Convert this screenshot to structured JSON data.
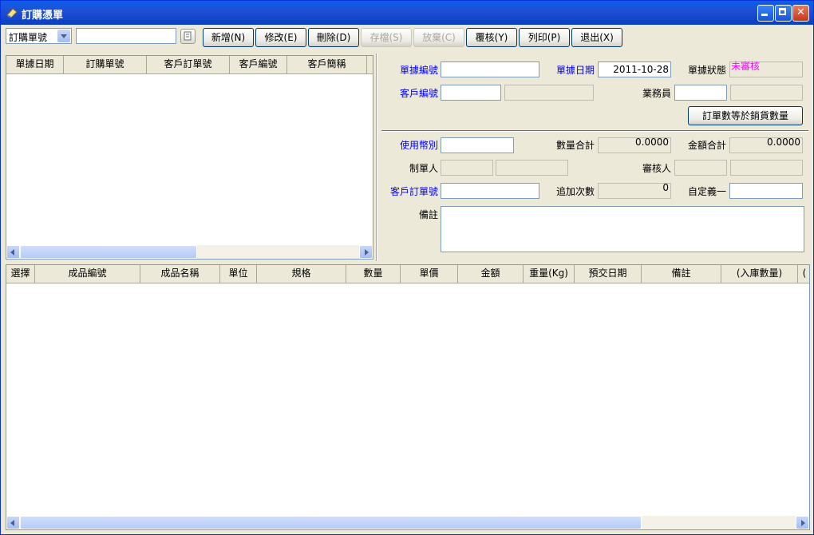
{
  "window": {
    "title": "訂購憑單"
  },
  "toolbar": {
    "search_field_selected": "訂購單號",
    "search_value": "",
    "buttons": {
      "add": "新增(N)",
      "edit": "修改(E)",
      "delete": "刪除(D)",
      "save": "存檔(S)",
      "cancel": "放棄(C)",
      "review": "覆核(Y)",
      "print": "列印(P)",
      "exit": "退出(X)"
    }
  },
  "order_list": {
    "columns": [
      "單據日期",
      "訂購單號",
      "客戶訂單號",
      "客戶編號",
      "客戶簡稱"
    ]
  },
  "form": {
    "doc_no_label": "單據編號",
    "doc_date_label": "單據日期",
    "doc_date_value": "2011-10-28",
    "doc_status_label": "單據狀態",
    "doc_status_value": "未審核",
    "customer_no_label": "客戶編號",
    "salesperson_label": "業務員",
    "match_button": "訂單數等於銷貨數量",
    "currency_label": "使用幣別",
    "qty_total_label": "數量合計",
    "qty_total_value": "0.0000",
    "amount_total_label": "金額合計",
    "amount_total_value": "0.0000",
    "creator_label": "制單人",
    "reviewer_label": "審核人",
    "customer_order_label": "客戶訂單號",
    "append_count_label": "追加次數",
    "append_count_value": "0",
    "custom1_label": "自定義一",
    "remarks_label": "備註"
  },
  "detail_grid": {
    "columns": [
      "選擇",
      "成品編號",
      "成品名稱",
      "單位",
      "規格",
      "數量",
      "單價",
      "金額",
      "重量(Kg)",
      "預交日期",
      "備註",
      "(入庫數量)",
      "("
    ]
  },
  "colors": {
    "title_bar": "#0a5fe8",
    "label_blue": "#0000ff",
    "status_magenta": "#ff00ff"
  }
}
